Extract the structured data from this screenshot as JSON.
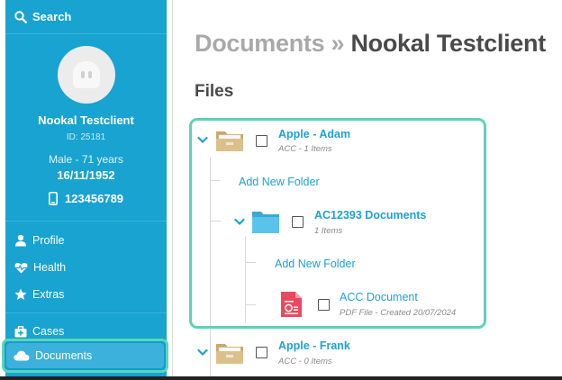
{
  "sidebar": {
    "search_label": "Search",
    "patient": {
      "name": "Nookal Testclient",
      "id": "ID: 25181",
      "sex_age": "Male - 71 years",
      "dob": "16/11/1952",
      "phone": "123456789"
    },
    "nav": {
      "profile": "Profile",
      "health": "Health",
      "extras": "Extras",
      "cases": "Cases",
      "documents": "Documents"
    }
  },
  "main": {
    "breadcrumb_parent": "Documents",
    "breadcrumb_sep": " » ",
    "breadcrumb_current": "Nookal Testclient",
    "files_heading": "Files",
    "tree": {
      "folder1": {
        "name": "Apple - Adam",
        "sub": "ACC - 1 Items"
      },
      "add_folder_1": "Add New Folder",
      "folder2": {
        "name": "AC12393 Documents",
        "sub": "1 Items"
      },
      "add_folder_2": "Add New Folder",
      "file1": {
        "name": "ACC Document",
        "sub": "PDF File - Created 20/07/2024"
      },
      "folder3": {
        "name": "Apple - Frank",
        "sub": "ACC - 0 Items"
      }
    }
  },
  "colors": {
    "sidebar_bg": "#18a3d0",
    "highlight": "#5ed3b6",
    "link": "#1ea1d2",
    "folder_tan": "#d4b67c",
    "folder_blue": "#4fbde6",
    "pdf_red": "#e9495e"
  }
}
